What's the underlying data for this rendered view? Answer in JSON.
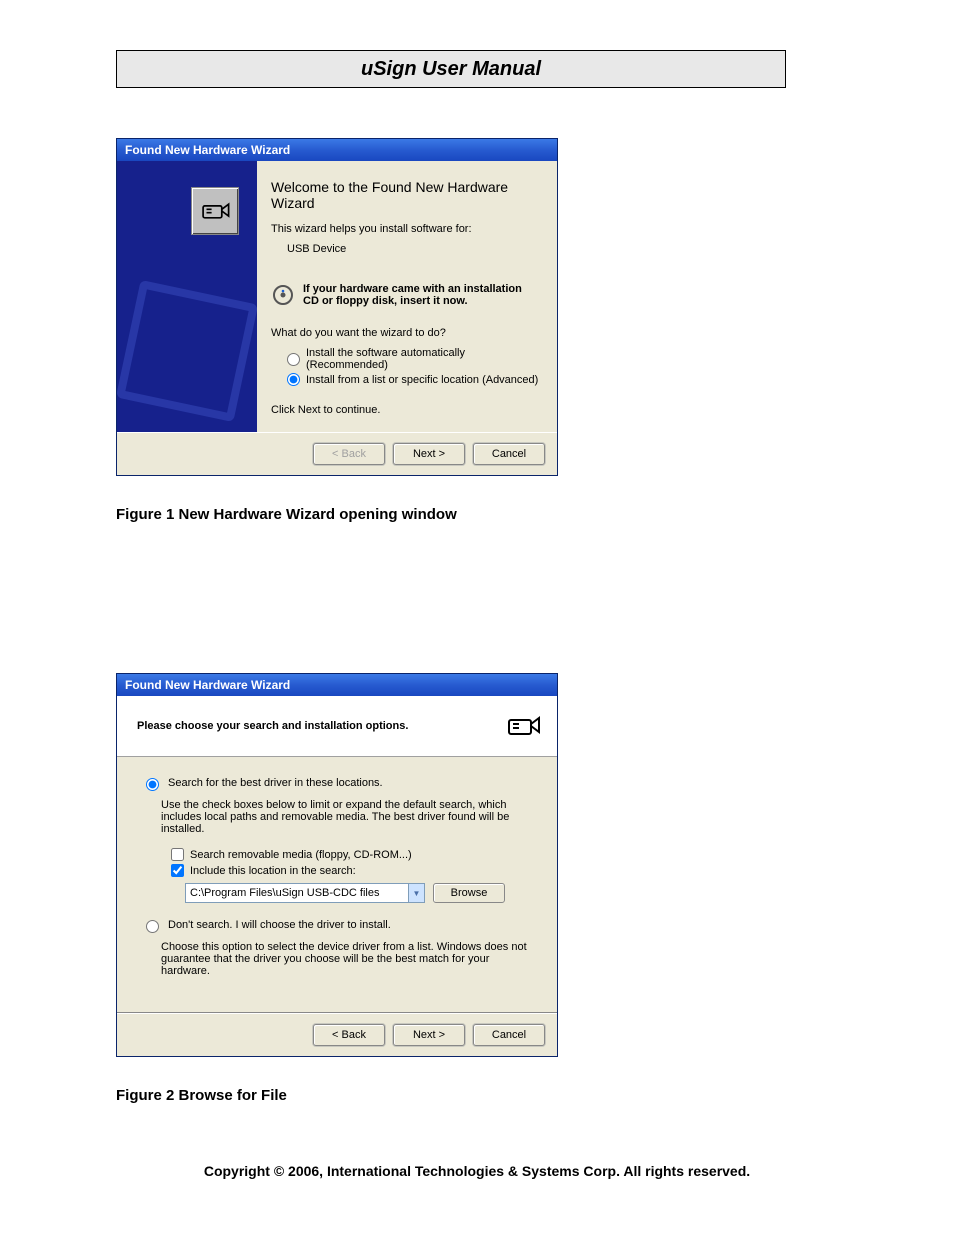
{
  "page": {
    "title": "uSign User Manual",
    "copyright": "Copyright © 2006, International Technologies & Systems Corp. All rights reserved."
  },
  "captions": {
    "fig1": "Figure 1   New Hardware Wizard opening window",
    "fig2": "Figure 2   Browse for File"
  },
  "wizard1": {
    "title": "Found New Hardware Wizard",
    "heading": "Welcome to the Found New Hardware Wizard",
    "helps_for": "This wizard helps you install software for:",
    "device": "USB Device",
    "hint": "If your hardware came with an installation CD or floppy disk, insert it now.",
    "question": "What do you want the wizard to do?",
    "opt_auto": "Install the software automatically (Recommended)",
    "opt_list": "Install from a list or specific location (Advanced)",
    "continue": "Click Next to continue.",
    "buttons": {
      "back": "< Back",
      "next": "Next >",
      "cancel": "Cancel"
    }
  },
  "wizard2": {
    "title": "Found New Hardware Wizard",
    "header": "Please choose your search and installation options.",
    "opt_search": "Search for the best driver in these locations.",
    "search_explain": "Use the check boxes below to limit or expand the default search, which includes local paths and removable media. The best driver found will be installed.",
    "chk_removable": "Search removable media (floppy, CD-ROM...)",
    "chk_include": "Include this location in the search:",
    "path": "C:\\Program Files\\uSign USB-CDC files",
    "browse": "Browse",
    "opt_dont": "Don't search. I will choose the driver to install.",
    "dont_explain": "Choose this option to select the device driver from a list.  Windows does not guarantee that the driver you choose will be the best match for your hardware.",
    "buttons": {
      "back": "< Back",
      "next": "Next >",
      "cancel": "Cancel"
    }
  }
}
